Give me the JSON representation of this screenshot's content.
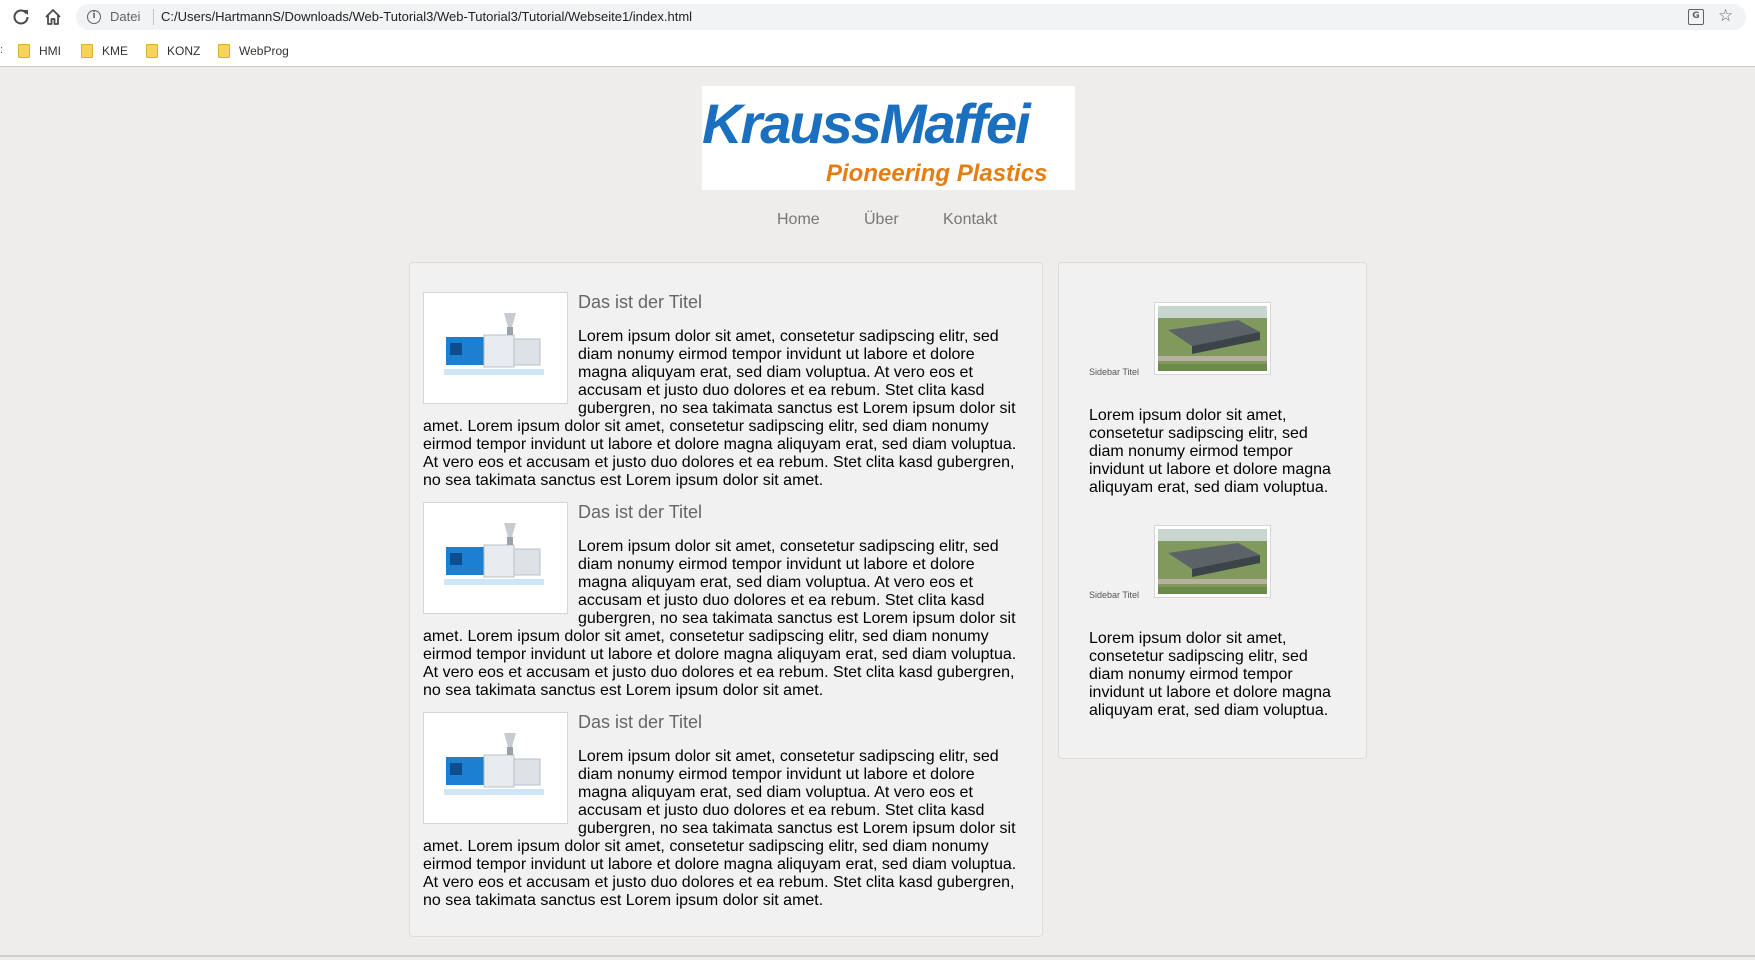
{
  "browser": {
    "scheme_label": "Datei",
    "url": "C:/Users/HartmannS/Downloads/Web-Tutorial3/Web-Tutorial3/Tutorial/Webseite1/index.html",
    "bookmarks": [
      {
        "label": "HMI"
      },
      {
        "label": "KME"
      },
      {
        "label": "KONZ"
      },
      {
        "label": "WebProg"
      }
    ]
  },
  "logo": {
    "main": "KraussMaffei",
    "sub": "Pioneering Plastics",
    "colors": {
      "main": "#1a6fbf",
      "sub": "#e57d10"
    }
  },
  "nav": {
    "items": [
      {
        "label": "Home"
      },
      {
        "label": "Über"
      },
      {
        "label": "Kontakt"
      }
    ]
  },
  "articles": [
    {
      "title": "Das ist der Titel",
      "text": "Lorem ipsum dolor sit amet, consetetur sadipscing elitr, sed diam nonumy eirmod tempor invidunt ut labore et dolore magna aliquyam erat, sed diam voluptua. At vero eos et accusam et justo duo dolores et ea rebum. Stet clita kasd gubergren, no sea takimata sanctus est Lorem ipsum dolor sit amet. Lorem ipsum dolor sit amet, consetetur sadipscing elitr, sed diam nonumy eirmod tempor invidunt ut labore et dolore magna aliquyam erat, sed diam voluptua. At vero eos et accusam et justo duo dolores et ea rebum. Stet clita kasd gubergren, no sea takimata sanctus est Lorem ipsum dolor sit amet."
    },
    {
      "title": "Das ist der Titel",
      "text": "Lorem ipsum dolor sit amet, consetetur sadipscing elitr, sed diam nonumy eirmod tempor invidunt ut labore et dolore magna aliquyam erat, sed diam voluptua. At vero eos et accusam et justo duo dolores et ea rebum. Stet clita kasd gubergren, no sea takimata sanctus est Lorem ipsum dolor sit amet. Lorem ipsum dolor sit amet, consetetur sadipscing elitr, sed diam nonumy eirmod tempor invidunt ut labore et dolore magna aliquyam erat, sed diam voluptua. At vero eos et accusam et justo duo dolores et ea rebum. Stet clita kasd gubergren, no sea takimata sanctus est Lorem ipsum dolor sit amet."
    },
    {
      "title": "Das ist der Titel",
      "text": "Lorem ipsum dolor sit amet, consetetur sadipscing elitr, sed diam nonumy eirmod tempor invidunt ut labore et dolore magna aliquyam erat, sed diam voluptua. At vero eos et accusam et justo duo dolores et ea rebum. Stet clita kasd gubergren, no sea takimata sanctus est Lorem ipsum dolor sit amet. Lorem ipsum dolor sit amet, consetetur sadipscing elitr, sed diam nonumy eirmod tempor invidunt ut labore et dolore magna aliquyam erat, sed diam voluptua. At vero eos et accusam et justo duo dolores et ea rebum. Stet clita kasd gubergren, no sea takimata sanctus est Lorem ipsum dolor sit amet."
    }
  ],
  "sidebar": {
    "items": [
      {
        "caption": "Sidebar Titel",
        "text": "Lorem ipsum dolor sit amet, consetetur sadipscing elitr, sed diam nonumy eirmod tempor invidunt ut labore et dolore magna aliquyam erat, sed diam voluptua."
      },
      {
        "caption": "Sidebar Titel",
        "text": "Lorem ipsum dolor sit amet, consetetur sadipscing elitr, sed diam nonumy eirmod tempor invidunt ut labore et dolore magna aliquyam erat, sed diam voluptua."
      }
    ]
  },
  "icons": [
    "reload-icon",
    "home-icon",
    "info-icon",
    "translate-icon",
    "star-icon",
    "folder-icon"
  ]
}
